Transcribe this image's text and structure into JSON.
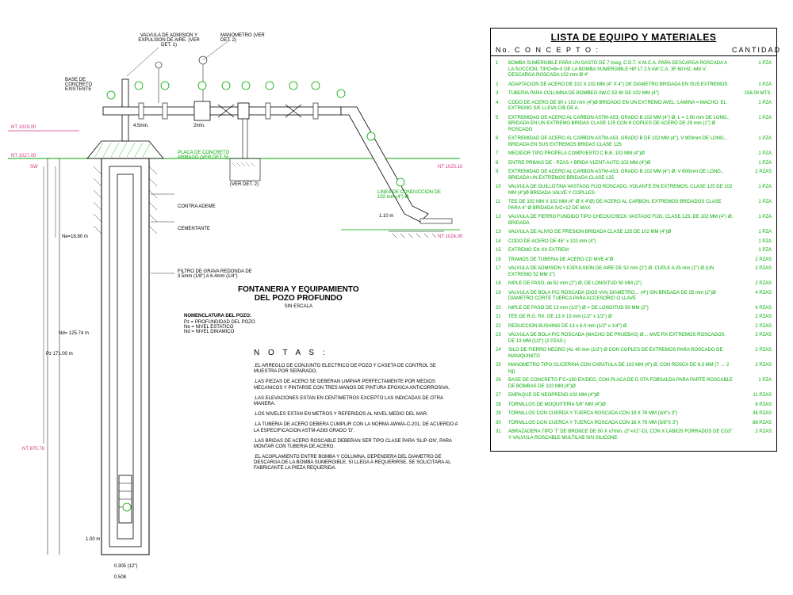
{
  "title": {
    "line1": "FONTANERIA Y EQUIPAMIENTO",
    "line2": "DEL POZO PROFUNDO",
    "scale": "SIN ESCALA"
  },
  "nomenclature": {
    "header": "NOMENCLATURA DEL POZO:",
    "items": [
      "Pz = PROFUNDIDAD DEL POZO",
      "Ne = NIVEL ESTATICO",
      "Nd = NIVEL DINAMICO"
    ]
  },
  "notes": {
    "header": "N O T A S :",
    "items": [
      ".EL ARREGLO DE CONJUNTO ELECTRICO DE POZO Y CASETA DE CONTROL SE MUESTRA POR SEPARADO.",
      ".LAS PIEZAS DE ACERO SE DEBERAN LIMPIAR PERFECTAMENTE POR MEDIOS MECANICOS Y PINTARSE CON TRES MANOS DE PINTURA EPOXICA ANTICORROSIVA.",
      ".LAS ELEVACIONES ESTAN EN CENTIMETROS EXCEPTO LAS INDICADAS DE OTRA MANERA.",
      ".LOS NIVELES ESTAN EN METROS Y REFERIDOS AL NIVEL MEDIO DEL MAR.",
      ".LA TUBERIA DE ACERO DEBERA CUMPLIR CON LA NORMA AWWA-C-201, DE ACUERDO A LA ESPECIFICACION ASTM-A283 GRADO 'D'.",
      ".LAS BRIDAS DE ACERO ROSCABLE DEBERAN SER TIPO CLASE PARA 'SLIP-ON', PARA MONTAR CON TUBERIA DE ACERO.",
      ".EL ACOPLAMIENTO ENTRE BOMBA Y COLUMNA, DEPENDERA DEL DIAMETRO DE DESCARGA DE LA BOMBA SUMERGIBLE, SI LLEGA A REQUERIRSE, SE SOLICITARA AL FABRICANTE LA PIEZA REQUERIDA."
    ]
  },
  "drawing_labels": {
    "top1": "VALVULA DE ADMISION Y EXPULSION DE AIRE. (VER DET. 1)",
    "top2": "MANOMETRO (VER DET. 2)",
    "base": "BASE DE CONCRETO EXISTENTE",
    "nt1": "NT 1029.00",
    "nt2": "NT 1027.00",
    "sw": "SW",
    "brocal": "PLACA DE CONCRETO ARMADO (VER DET. 5)",
    "verdet2": "(VER DET. 2)",
    "linea": "LINEA DE CONDUCCION DE 102 mm (4\") Ø.",
    "nt3": "NT 1025.10",
    "nt4": "NT 1024.00",
    "contra": "CONTRA ADEME",
    "cement": "CEMENTANTE",
    "filtro": "FILTRO DE GRAVA REDONDA DE 3.5mm (1/8\") A 6.4mm (1/4\")",
    "ne": "Ne=18.80 m",
    "pz": "Pz 171.00 m",
    "dim1": "4.5min.",
    "dim2": "2min.",
    "dim3": "1.10 m",
    "dim4": "1.00 m",
    "dim5": "0.305 (12\")",
    "dim6": "0.508",
    "nd": "Nd= 125.74 m",
    "nt5": "NT 870.78"
  },
  "materials": {
    "header": "LISTA DE EQUIPO Y MATERIALES",
    "col_no": "No.",
    "col_concept": "C O N C E P T O :",
    "col_qty": "CANTIDAD",
    "rows": [
      {
        "n": "1",
        "c": "BOMBA SUMERGIBLE PARA UN GASTO DE 7 l/seg, C.D.T. X M.C.A. PARA DESCARGA ROSCADA A LA SUCCION, TIPO=B=X DE LA BOMBA SUMERGIBLE HP 17 2.5 kW C.A. 3F 60 HZ, 440 V. DESCARGA ROSCADA 102 mm Ø 4\"",
        "q": "1 PZA"
      },
      {
        "n": "2",
        "c": "ADAPTACION DE ACERO DE 102 X 102 MM (4\" X 4\") DE DIAMETRO BRIDADA EN SUS EXTREMOS",
        "q": "1 PZA"
      },
      {
        "n": "3",
        "c": "TUBERIA PARA COLUMNA DE BOMBEO AW.C 53 40 DE 102 MM (4\")",
        "q": "156.00 MTS."
      },
      {
        "n": "4",
        "c": "CODO DE ACERO DE 90 x 102 mm (4\")Ø BRIDADO EN UN EXTREMO AVEL; LAMINA = MACHO, EL EXTREMO S/E LLEVA C/B DE A.",
        "q": "1 PZA"
      },
      {
        "n": "5",
        "c": "EXTREMIDAD DE ACERO AL CARBON ASTM-A53, GRADO B 102 MM (4\") Ø, L = 1.50 mm DE LONG., BRIDADA EN UN EXTREMO BRIDAS CLASE 125 CON 8 COPLES DE ACERO DE 25 mm (1\") Ø ROSCADO",
        "q": "1 PZA"
      },
      {
        "n": "6",
        "c": "EXTREMIDAD DE ACERO AL CARBON ASTM-A53, GRADO B DE 102 MM (4\"), V 900mm DE LONG., BRIDADA EN SUS EXTREMOS BRIDAS CLASE 125",
        "q": "1 PZA"
      },
      {
        "n": "7",
        "c": "MEDIDOR TIPO PROPELA COMPUESTO C.B.B. 102 MM (4\")Ø",
        "q": "1 PZA"
      },
      {
        "n": "8",
        "c": "ENTRE PRIMAS DE - PZAS.+ BRIDA VLENT-AUTO 102 MM (4\")Ø",
        "q": "1 PZA"
      },
      {
        "n": "9",
        "c": "EXTREMIDAD DE ACERO AL CARBON ASTM-A53, GRADO B 102 MM (4\") Ø, V 600mm DE LONG., BRIDADA UN EXTREMOS BRIDADA CLASE 125",
        "q": "2 PZAS"
      },
      {
        "n": "10",
        "c": "VALVULA DE GUILLOTINA VASTAGO FIJO ROSCADO, VOLANTE EN EXTREMOS, CLASE 125 DE 102 MM (4\")Ø BRIDADA VALVE Y COPLLES.",
        "q": "1 PZA"
      },
      {
        "n": "11",
        "c": "TEE DE 102 MM X 102 MM (4\" Ø X 4\"Ø) DE ACERO AL CARBON, EXTREMOS BRIDADOS CLASE PARA 4\" Ø BRIDADA S/C=12 DE MAX",
        "q": "1 PZA"
      },
      {
        "n": "12",
        "c": "VALVULA DE FIERRO FUNDIDO TIPO CHECK/CHECK VASTAGO FIJO, CLASE 125, DE 102 MM (4\") Ø, BRIDADA",
        "q": "1 PZA"
      },
      {
        "n": "13",
        "c": "VALVULA DE ALIVIO DE PRESION BRIDADA CLASE 125 DE 102 MM (4\")Ø",
        "q": "1 PZA"
      },
      {
        "n": "14",
        "c": "CODO DE ACERO DE 45° x 102 mm (4\")",
        "q": "1 PZA"
      },
      {
        "n": "15",
        "c": "EXTREMO EN XX EXTREM",
        "q": "1 PZA"
      },
      {
        "n": "16",
        "c": "TRAMOS DE TUBERIA DE ACERO CD MVE 4\"Ø",
        "q": "2 PZAS"
      },
      {
        "n": "17",
        "c": "VALVULA DE ADMISION Y EXPULSION DE AIRE DE 52 mm (2\") Ø, CUPLE A 25 mm (1\") Ø (UN EXTREMO 52 MM 2\")",
        "q": "2 PZAS"
      },
      {
        "n": "18",
        "c": "NIPLE DE PASO, de 52 mm (2\") Ø, DE LONGITUD 50 MM (2\")",
        "q": "2 PZAS"
      },
      {
        "n": "19",
        "c": "VALVULA DE BOLA P/C ROSCADA (DOS VIA) DIAMETRO… (4\") SIN BRIDADA DE 25 mm (2\")Ø DIAMETRO CORTE TUERCA PARA ACCESORIO O LLAVE",
        "q": "4 PZAS"
      },
      {
        "n": "20",
        "c": "NIPLE DE PASO DE 13 mm (1/2\") Ø = DE LONGITUD 50 MM (2\")",
        "q": "4 PZAS"
      },
      {
        "n": "21",
        "c": "TEE DE R.G. RX. DE 13 X 13 mm (1/2\" x 1/2\") Ø",
        "q": "2 PZAS"
      },
      {
        "n": "22",
        "c": "REDUCCION BUSHING  DE 13 x 6.0 mm (1/2\" x 1/4\") Ø",
        "q": "2 PZAS"
      },
      {
        "n": "23",
        "c": "VALVULA DE BOLA P/C ROSCADA (MACHO DE PRUEBAS) Ø… MVE RX EXTREMOS ROSCADOS, DE 13 MM (1/2\") (2 PZAS.)",
        "q": "2 PZAS"
      },
      {
        "n": "24",
        "c": "SILO DE FIERRO NEGRO (AL 40 mm (1/2\") Ø CON COPLES DE EXTREMOS PARA ROSCADO DE MANIQUINITO",
        "q": "2 PZAS"
      },
      {
        "n": "25",
        "c": "MANOMETRO TIPO GLICERINA CON CARATULA DE 102 MM (4\") Ø, CON ROSCA DE 6.3 MM (7 → 2 kg)",
        "q": "2 PZAS"
      },
      {
        "n": "26",
        "c": "BASE DE CONCRETO F'C=150 EX/DEG, CON PLACA DE D STA FOBSALDA PARA PARTE ROSCABLE DE BOMBAS DE 102 MM (4\")Ø",
        "q": "1 PZA"
      },
      {
        "n": "27",
        "c": "EMPAQUE DE NEOPRENO 102 MM (4\")Ø",
        "q": "11 PZAS"
      },
      {
        "n": "28",
        "c": "TORNILLOS DE MOQUITERIA 5/8\" MM (4\")Ø",
        "q": "8 PZAS"
      },
      {
        "n": "29",
        "c": "TORNILLOS CON CUERDA Y TUERCA ROSCADA CON 19 X 76 MM (3/4\"x 3\")",
        "q": "36 PZAS"
      },
      {
        "n": "30",
        "c": "TORNILLOS CON CUERCA Y TUERCA ROSCADA CON 16 X 76 MM (5/8\"X 3\")",
        "q": "88 PZAS"
      },
      {
        "n": "31",
        "c": "ABRAZADERA TIPO 'T' DE BRONCE DE 50 X x7mm, (2\"=X1\"-D), CON X LABIOS FORRADOS DE CG3\" Y VALVULA ROSCABLE MULTILAB SIN SILICONE",
        "q": "2 PZAS"
      }
    ]
  }
}
